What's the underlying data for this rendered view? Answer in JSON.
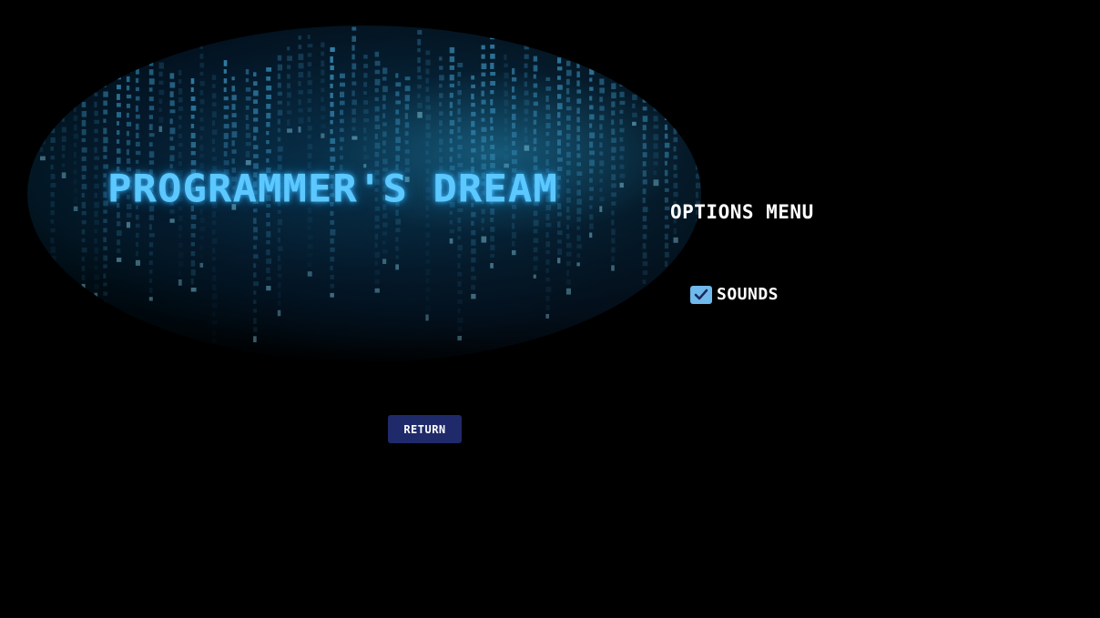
{
  "game": {
    "title": "PROGRAMMER'S DREAM"
  },
  "options_menu": {
    "title": "OPTIONS MENU",
    "options": [
      {
        "label": "SOUNDS",
        "checked": true
      }
    ],
    "return_label": "RETURN"
  },
  "colors": {
    "background": "#000000",
    "title_glow": "#5cc8ff",
    "checkbox": "#6fb9ec",
    "button": "#1f2a6a",
    "text": "#ffffff"
  },
  "icons": {
    "checkbox": "checkmark-icon"
  }
}
